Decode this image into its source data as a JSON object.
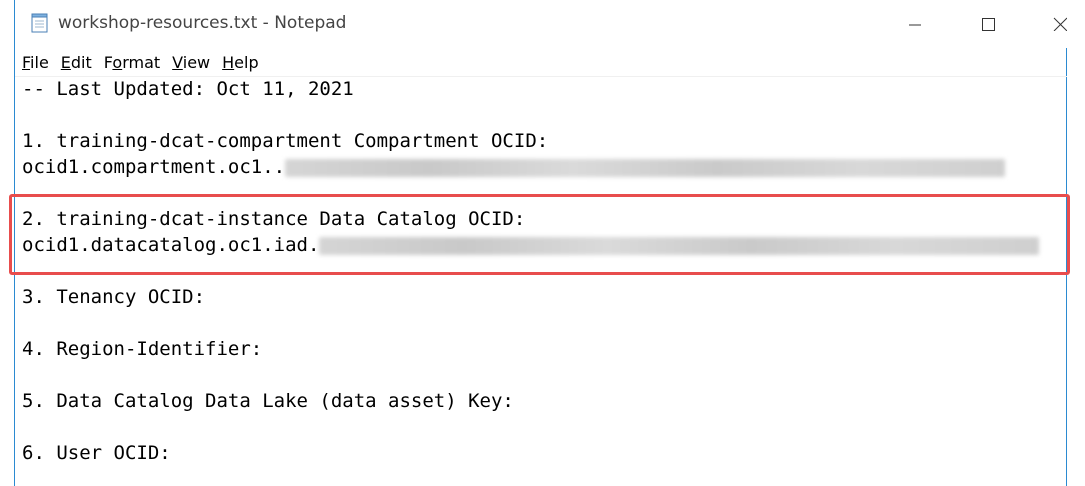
{
  "window": {
    "title": "workshop-resources.txt - Notepad",
    "icon": "notepad-icon",
    "accent_color": "#2b8ad1",
    "highlight_color": "#e84d4d"
  },
  "controls": {
    "minimize_icon": "minimize-icon",
    "maximize_icon": "maximize-icon",
    "close_icon": "close-icon"
  },
  "menu": [
    {
      "label": "File",
      "mnemonic": "F",
      "rest": "ile"
    },
    {
      "label": "Edit",
      "mnemonic": "E",
      "rest": "dit"
    },
    {
      "label": "Format",
      "pre": "F",
      "mnemonic": "o",
      "rest": "rmat"
    },
    {
      "label": "View",
      "mnemonic": "V",
      "rest": "iew"
    },
    {
      "label": "Help",
      "mnemonic": "H",
      "rest": "elp"
    }
  ],
  "lines": {
    "updated": "-- Last Updated: Oct 11, 2021",
    "item1_title": "1. training-dcat-compartment Compartment OCID:",
    "item1_value": "ocid1.compartment.oc1..",
    "item2_title": "2. training-dcat-instance Data Catalog OCID:",
    "item2_value": "ocid1.datacatalog.oc1.iad.",
    "item3": "3. Tenancy OCID:",
    "item4": "4. Region-Identifier:",
    "item5": "5. Data Catalog Data Lake (data asset) Key:",
    "item6": "6. User OCID:"
  }
}
